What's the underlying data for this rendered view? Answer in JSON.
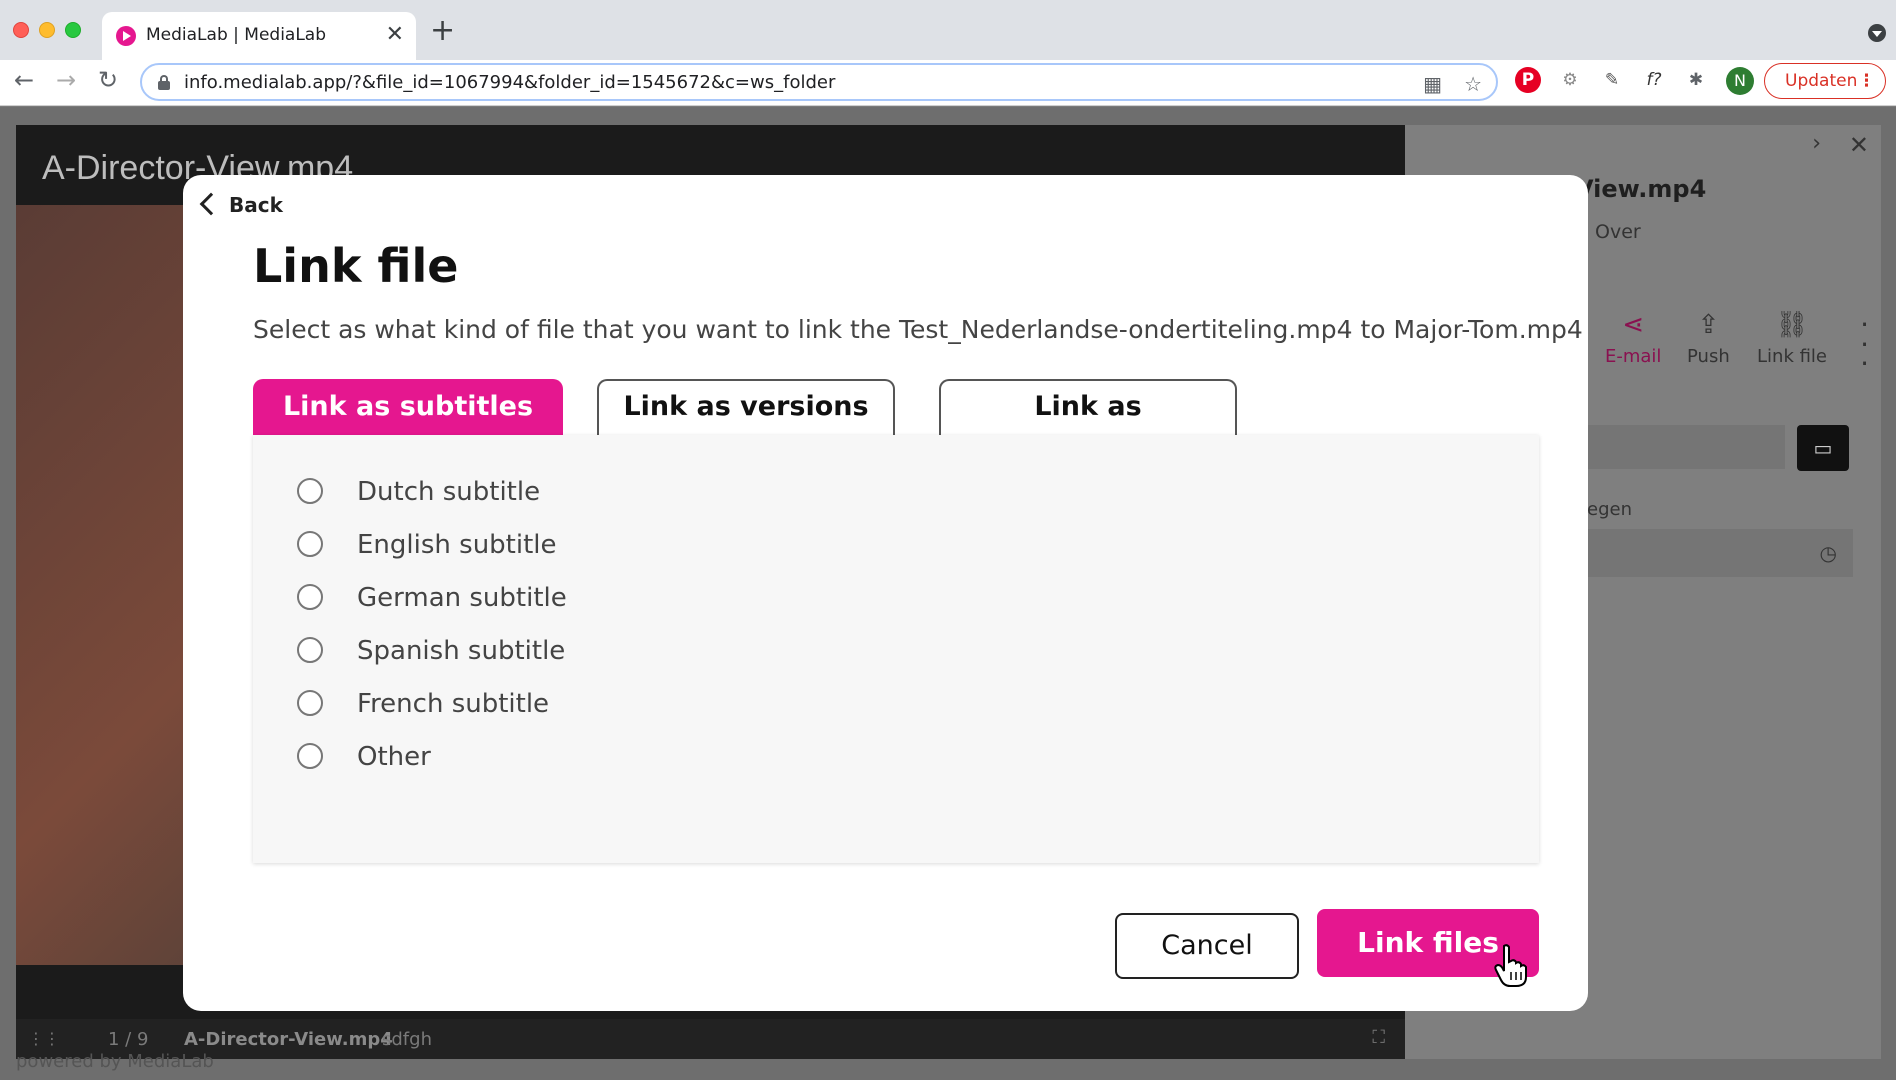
{
  "browser": {
    "tab_title": "MediaLab | MediaLab",
    "tab_close": "✕",
    "new_tab": "+",
    "url": "info.medialab.app/?&file_id=1067994&folder_id=1545672&c=ws_folder",
    "profile_initial": "N",
    "update_label": "Updaten",
    "update_dots": "⋮",
    "nav": {
      "back": "←",
      "forward": "→",
      "reload": "↻"
    },
    "ext_f": "f?"
  },
  "background_page": {
    "player_title": "A-Director-View.mp4",
    "counter": "1 / 9",
    "file_name": "A-Director-View.mp4",
    "tag": "sdfgh",
    "powered_by": "powered by MediaLab",
    "side_title": "View.mp4",
    "side_subtitle": "Over",
    "actions": [
      {
        "label": "E-mail",
        "icon": "share-icon",
        "color": "#c0136f"
      },
      {
        "label": "Push",
        "icon": "upload-icon"
      },
      {
        "label": "Link file",
        "icon": "link-icon"
      }
    ],
    "field_label": "egen"
  },
  "modal": {
    "back_label": "Back",
    "title": "Link file",
    "description": "Select as what kind of file that you want to link the Test_Nederlandse-ondertiteling.mp4 to Major-Tom.mp4",
    "tabs": [
      {
        "label": "Link as subtitles",
        "active": true
      },
      {
        "label": "Link as versions",
        "active": false
      },
      {
        "label": "Link as translations",
        "active": false
      }
    ],
    "options": [
      "Dutch subtitle",
      "English subtitle",
      "German subtitle",
      "Spanish subtitle",
      "French subtitle",
      "Other"
    ],
    "cancel_label": "Cancel",
    "confirm_label": "Link files"
  },
  "colors": {
    "accent": "#e5178f",
    "overlay": "#6e6e6e"
  }
}
